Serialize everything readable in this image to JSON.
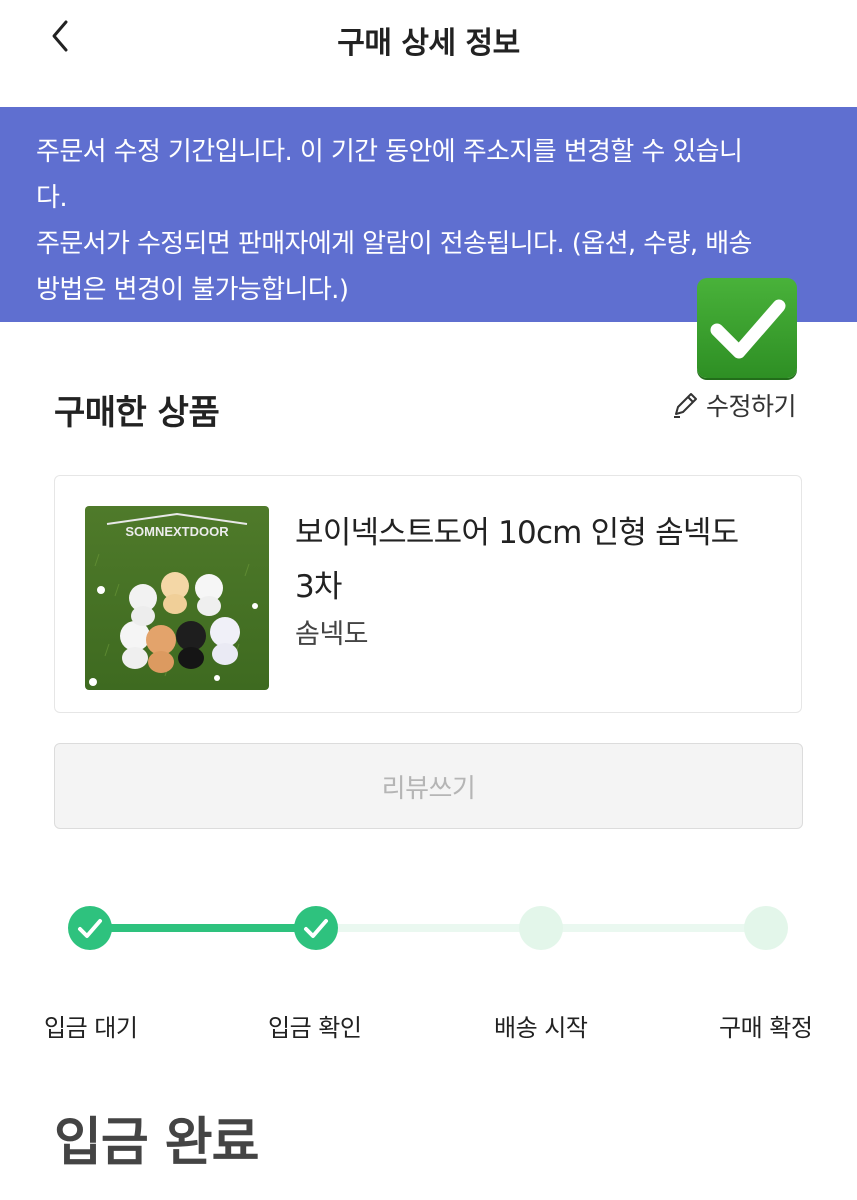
{
  "header": {
    "title": "구매 상세 정보",
    "back_icon": "chevron-left-icon"
  },
  "notice": {
    "lines": [
      "주문서 수정 기간입니다. 이 기간 동안에 주소지를 변경할 수 있습니",
      "다.",
      "주문서가 수정되면 판매자에게 알람이 전송됩니다. (옵션, 수량, 배송",
      "방법은 변경이 불가능합니다.)"
    ],
    "background": "#5f6fd0"
  },
  "overlay": {
    "icon": "green-checkmark-icon"
  },
  "purchased": {
    "section_title": "구매한 상품",
    "edit_label": "수정하기",
    "edit_icon": "pencil-icon"
  },
  "product": {
    "name": "보이넥스트도어 10cm 인형 솜넥도 3차",
    "brand": "솜넥도",
    "image_text": "SOMNEXTDOOR"
  },
  "review_button": {
    "label": "리뷰쓰기"
  },
  "progress": {
    "steps": [
      {
        "label": "입금 대기",
        "done": true
      },
      {
        "label": "입금 확인",
        "done": true
      },
      {
        "label": "배송 시작",
        "done": false
      },
      {
        "label": "구매 확정",
        "done": false
      }
    ],
    "accent": "#2ec27e"
  },
  "status": {
    "text": "입금 완료"
  }
}
